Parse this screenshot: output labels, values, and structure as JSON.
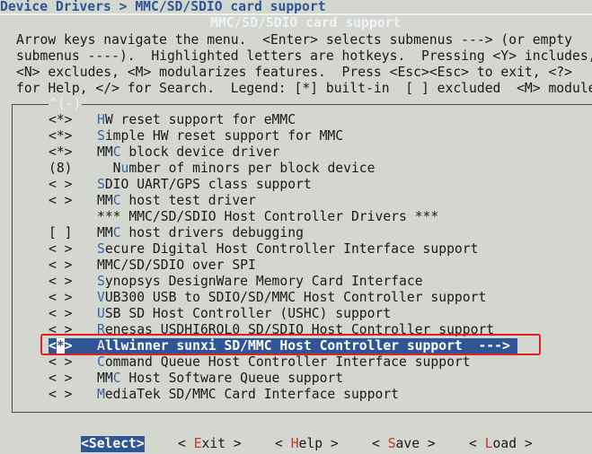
{
  "breadcrumb": "Device Drivers > MMC/SD/SDIO card support",
  "window_title": "MMC/SD/SDIO card support",
  "help_lines": [
    "Arrow keys navigate the menu.  <Enter> selects submenus ---> (or empty",
    "submenus ----).  Highlighted letters are hotkeys.  Pressing <Y> includes,",
    "<N> excludes, <M> modularizes features.  Press <Esc><Esc> to exit, <?>",
    "for Help, </> for Search.  Legend: [*] built-in  [ ] excluded  <M> module"
  ],
  "scroll_indicator": "^(-)",
  "menu": {
    "items": [
      {
        "mark": "<*>",
        "hot": "H",
        "rest": "W reset support for eMMC"
      },
      {
        "mark": "<*>",
        "hot": "S",
        "rest": "imple HW reset support for MMC"
      },
      {
        "mark": "<*>",
        "pre": "MM",
        "hot": "C",
        "rest": " block device driver"
      },
      {
        "mark": "(8)",
        "pre": "  N",
        "hot": "u",
        "rest": "mber of minors per block device"
      },
      {
        "mark": "< >",
        "hot": "S",
        "rest": "DIO UART/GPS class support"
      },
      {
        "mark": "< >",
        "pre": "MM",
        "hot": "C",
        "rest": " host test driver"
      },
      {
        "mark": "",
        "pre": "*** MMC/SD/SDIO Host Controller Drivers ***",
        "hot": "",
        "rest": ""
      },
      {
        "mark": "[ ]",
        "pre": "MM",
        "hot": "C",
        "rest": " host drivers debugging"
      },
      {
        "mark": "< >",
        "hot": "S",
        "rest": "ecure Digital Host Controller Interface support"
      },
      {
        "mark": "< >",
        "pre": "MMC/SD/SDIO over SPI",
        "hot": "",
        "rest": ""
      },
      {
        "mark": "< >",
        "hot": "S",
        "rest": "ynopsys DesignWare Memory Card Interface"
      },
      {
        "mark": "< >",
        "hot": "V",
        "rest": "UB300 USB to SDIO/SD/MMC Host Controller support"
      },
      {
        "mark": "< >",
        "hot": "U",
        "rest": "SB SD Host Controller (USHC) support"
      },
      {
        "mark": "< >",
        "hot": "R",
        "rest": "enesas USDHI6ROL0 SD/SDIO Host Controller support"
      },
      {
        "mark": "<*>",
        "hot": "A",
        "rest": "llwinner sunxi SD/MMC Host Controller support  --->",
        "selected": true
      },
      {
        "mark": "< >",
        "hot": "C",
        "rest": "ommand Queue Host Controller Interface support"
      },
      {
        "mark": "< >",
        "pre": "MM",
        "hot": "C",
        "rest": " Host Software Queue support"
      },
      {
        "mark": "< >",
        "hot": "M",
        "rest": "ediaTek SD/MMC Card Interface support"
      }
    ]
  },
  "buttons": [
    {
      "name": "select-button",
      "open": "<",
      "hk": "S",
      "rest": "elect",
      "close": ">",
      "active": true
    },
    {
      "name": "exit-button",
      "open": "< ",
      "hk": "E",
      "rest": "xit",
      "close": " >",
      "active": false
    },
    {
      "name": "help-button",
      "open": "< ",
      "hk": "H",
      "rest": "elp",
      "close": " >",
      "active": false
    },
    {
      "name": "save-button",
      "open": "< ",
      "hk": "S",
      "rest": "ave",
      "close": " >",
      "active": false
    },
    {
      "name": "load-button",
      "open": "< ",
      "hk": "L",
      "rest": "oad",
      "close": " >",
      "active": false
    }
  ],
  "colors": {
    "background": "#d3d7cf",
    "accent": "#2f5597",
    "hotkey": "#3465a4",
    "annotation": "#e02020"
  }
}
